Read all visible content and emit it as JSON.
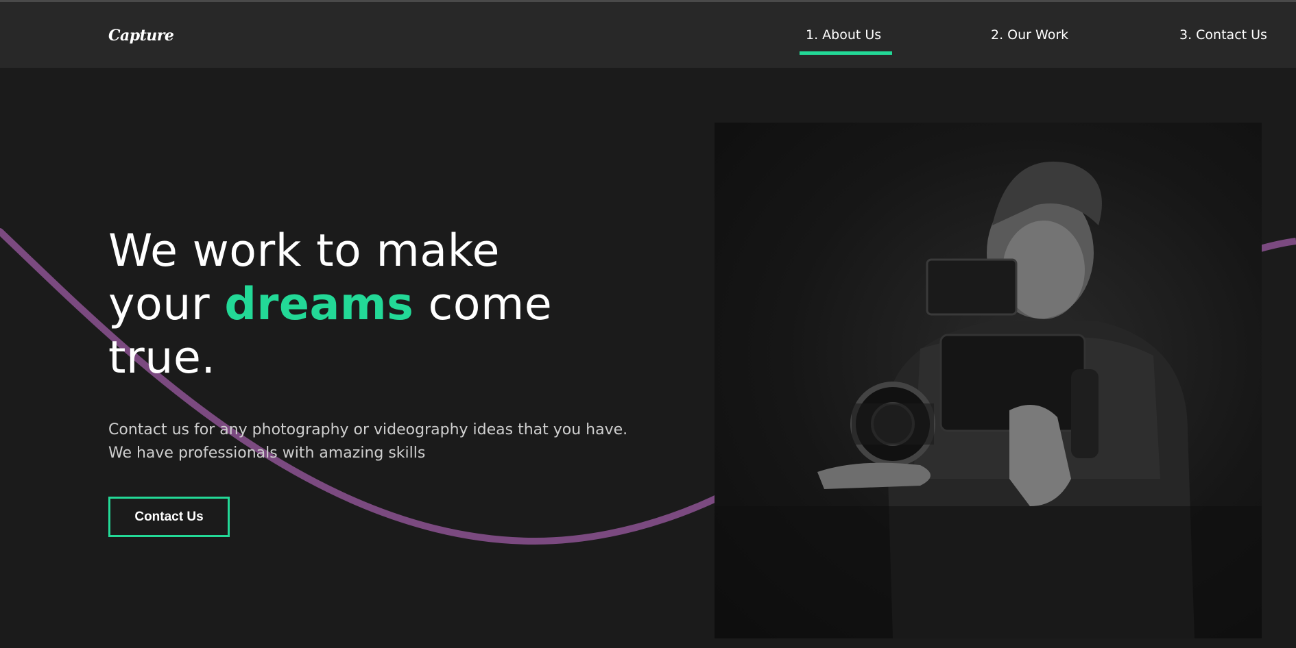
{
  "brand": {
    "logo_text": "Capture"
  },
  "nav": {
    "links": [
      {
        "label": "1. About Us",
        "active": true
      },
      {
        "label": "2. Our Work",
        "active": false
      },
      {
        "label": "3. Contact Us",
        "active": false
      }
    ]
  },
  "hero": {
    "headline_part1": "We work to make",
    "headline_part2": "your",
    "headline_accent": "dreams",
    "headline_part3": "come",
    "headline_part4": "true.",
    "description_line1": "Contact us for any photography or videography ideas that you have.",
    "description_line2": "We have professionals with amazing skills",
    "cta_label": "Contact Us"
  },
  "colors": {
    "background": "#1b1b1b",
    "nav_background": "#282828",
    "accent_green": "#23d997",
    "wave_purple": "#7b4a80"
  },
  "icons": {
    "hero_photo": "videographer-photo"
  }
}
